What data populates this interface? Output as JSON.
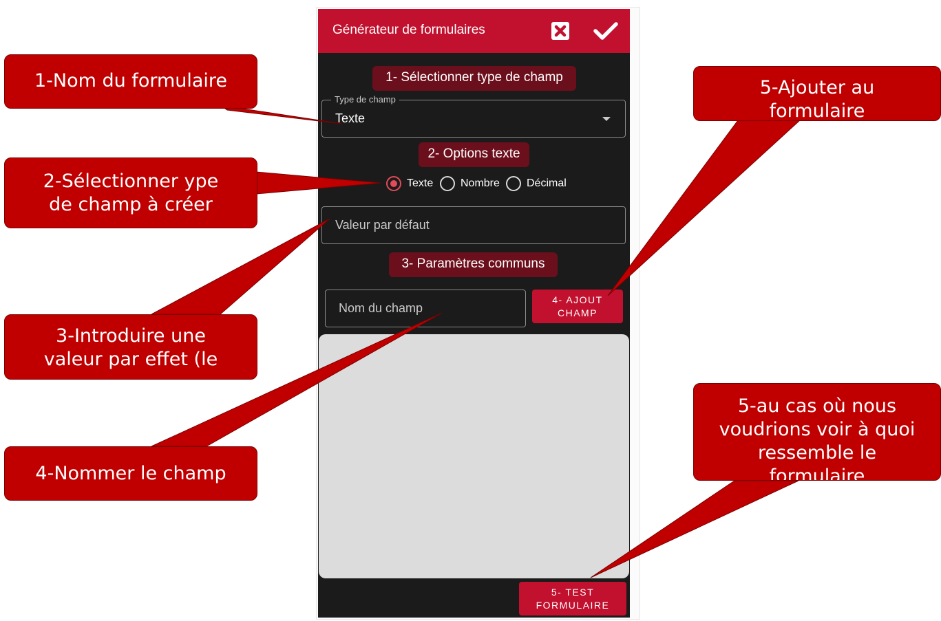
{
  "app": {
    "title": "Générateur de formulaires",
    "close_icon": "close-square-icon",
    "confirm_icon": "checkmark-icon",
    "accent_color": "#c1112e"
  },
  "sections": {
    "select_type": "1- Sélectionner type de champ",
    "text_options": "2- Options texte",
    "common_params": "3- Paramètres communs"
  },
  "field_type": {
    "legend": "Type de champ",
    "value": "Texte"
  },
  "text_options": {
    "options": [
      "Texte",
      "Nombre",
      "Décimal"
    ],
    "selected": "Texte"
  },
  "inputs": {
    "default_value_placeholder": "Valeur par défaut",
    "field_name_placeholder": "Nom du champ"
  },
  "buttons": {
    "add_field_line1": "4- AJOUT",
    "add_field_line2": "CHAMP",
    "test_form_line1": "5- TEST",
    "test_form_line2": "FORMULAIRE"
  },
  "annotations": {
    "note1": "1-Nom du formulaire",
    "note2_line1": "2-Sélectionner ype",
    "note2_line2": "de champ à créer",
    "note3_line1": "3-Introduire une",
    "note3_line2": "valeur par effet (le",
    "note4": "4-Nommer le champ",
    "note5_line1": "5-Ajouter au",
    "note5_line2": "formulaire",
    "note6_line1": "5-au cas où nous",
    "note6_line2": "voudrions voir à quoi",
    "note6_line3": "ressemble le",
    "note6_line4": "formulaire",
    "color": "#c00000"
  }
}
